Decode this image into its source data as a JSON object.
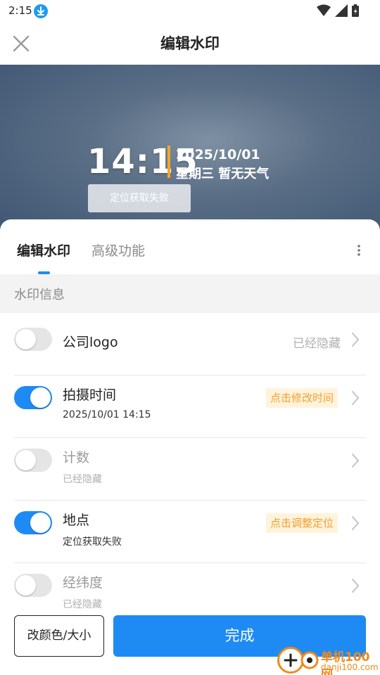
{
  "status_bar": {
    "time": "2:15"
  },
  "header": {
    "title": "编辑水印"
  },
  "preview": {
    "time": "14:15",
    "date": "2025/10/01",
    "weekday_weather": "星期三  暂无天气",
    "location_tag": "定位获取失败",
    "accent_color": "#f5a623"
  },
  "tabs": [
    {
      "label": "编辑水印",
      "active": true
    },
    {
      "label": "高级功能",
      "active": false
    }
  ],
  "section": {
    "title": "水印信息"
  },
  "rows": [
    {
      "title": "公司logo",
      "right_text": "已经隐藏",
      "toggle": "off"
    },
    {
      "title": "拍摄时间",
      "subtitle": "2025/10/01 14:15",
      "badge": "点击修改时间",
      "toggle": "on"
    },
    {
      "title": "计数",
      "subtitle": "已经隐藏",
      "toggle": "off"
    },
    {
      "title": "地点",
      "subtitle": "定位获取失败",
      "badge": "点击调整定位",
      "toggle": "on"
    },
    {
      "title": "经纬度",
      "subtitle": "已经隐藏",
      "toggle": "off"
    }
  ],
  "buttons": {
    "color_size": "改颜色/大小",
    "done": "完成"
  },
  "site_watermark": {
    "name": "单机100网",
    "url": "danji100.com"
  },
  "colors": {
    "primary": "#1e8bf5",
    "badge_text": "#f0a030",
    "badge_bg": "#fff3dc"
  }
}
